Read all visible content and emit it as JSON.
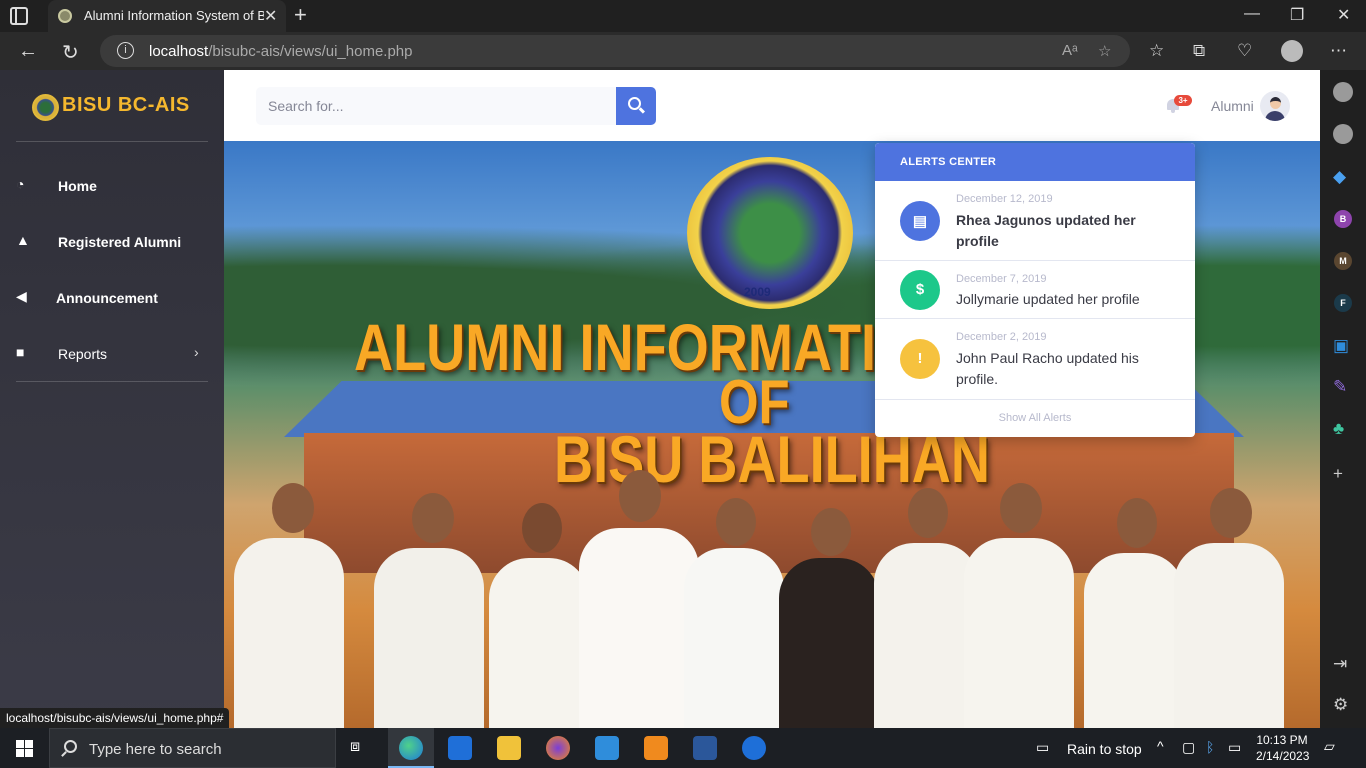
{
  "browser": {
    "tab_title": "Alumni Information System of BISU",
    "tab_close": "✕",
    "new_tab": "+",
    "url_host": "localhost",
    "url_path": "/bisubc-ais/views/ui_home.php",
    "status_url": "localhost/bisubc-ais/views/ui_home.php#"
  },
  "sidebar": {
    "brand": "BISU BC-AIS",
    "items": [
      {
        "label": "Home",
        "icon": "dashboard-icon"
      },
      {
        "label": "Registered Alumni",
        "icon": "graduation-cap-icon"
      },
      {
        "label": "Announcement",
        "icon": "bullhorn-icon"
      },
      {
        "label": "Reports",
        "icon": "folder-icon"
      }
    ]
  },
  "topbar": {
    "search_placeholder": "Search for...",
    "alert_badge": "3+",
    "user_name": "Alumni"
  },
  "hero": {
    "seal_year": "2009",
    "title_line1": "ALUMNI INFORMATI",
    "title_line2": "OF",
    "title_line3": "BISU BALILIHAN"
  },
  "alerts": {
    "header": "ALERTS CENTER",
    "items": [
      {
        "date": "December 12, 2019",
        "text": "Rhea Jagunos updated her profile",
        "icon": "file-icon",
        "color": "#4e73df",
        "unread": true
      },
      {
        "date": "December 7, 2019",
        "text": "Jollymarie updated her profile",
        "icon": "money-icon",
        "color": "#1cc88a",
        "unread": false
      },
      {
        "date": "December 2, 2019",
        "text": "John Paul Racho updated his profile.",
        "icon": "warning-icon",
        "color": "#f6c23e",
        "unread": false
      }
    ],
    "footer": "Show All Alerts"
  },
  "taskbar": {
    "search_text": "Type here to search",
    "weather": "Rain to stop",
    "time": "10:13 PM",
    "date": "2/14/2023"
  },
  "colors": {
    "primary": "#4e73df",
    "brand_gold": "#f5b82e",
    "badge_red": "#e74a3b"
  }
}
